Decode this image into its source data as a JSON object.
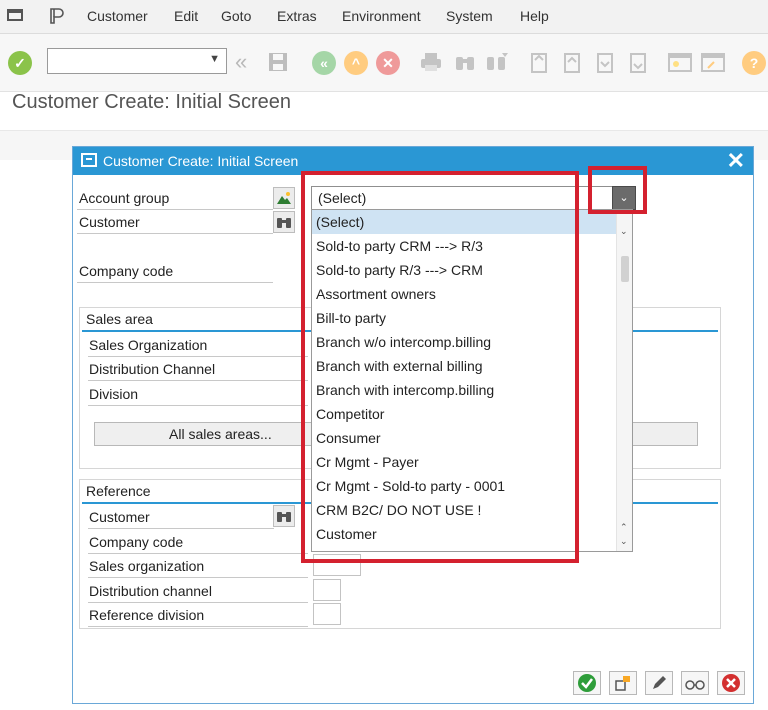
{
  "menu": {
    "items": [
      "Customer",
      "Edit",
      "Goto",
      "Extras",
      "Environment",
      "System",
      "Help"
    ]
  },
  "toolbar": {
    "command_field_value": "",
    "icons": [
      "enter-icon",
      "back-arrows-icon",
      "save-icon",
      "back-icon",
      "exit-icon",
      "cancel-icon",
      "print-icon",
      "find-icon",
      "find-next-icon",
      "first-page-icon",
      "previous-page-icon",
      "next-page-icon",
      "last-page-icon",
      "new-session-icon",
      "shortcut-icon",
      "help-icon"
    ]
  },
  "page": {
    "title": "Customer Create: Initial Screen"
  },
  "dialog": {
    "title": "Customer Create: Initial Screen",
    "account_group_label": "Account group",
    "customer_label": "Customer",
    "company_code_label": "Company code",
    "sales_area": {
      "title": "Sales area",
      "fields": [
        "Sales Organization",
        "Distribution Channel",
        "Division"
      ],
      "all_sales_areas_button": "All sales areas..."
    },
    "reference": {
      "title": "Reference",
      "fields": [
        "Customer",
        "Company code",
        "Sales organization",
        "Distribution channel",
        "Reference division"
      ]
    },
    "footer_buttons": [
      "continue-icon",
      "create-with-data-icon",
      "edit-icon",
      "glasses-icon",
      "cancel-icon"
    ]
  },
  "dropdown": {
    "selected_value": "(Select)",
    "options": [
      "(Select)",
      "Sold-to party CRM ---> R/3",
      "Sold-to party R/3 ---> CRM",
      "Assortment owners",
      "Bill-to party",
      "Branch w/o intercomp.billing",
      "Branch with external billing",
      "Branch with intercomp.billing",
      "Competitor",
      "Consumer",
      "Cr Mgmt - Payer",
      "Cr Mgmt - Sold-to party - 0001",
      "CRM B2C/ DO NOT USE !",
      "Customer"
    ]
  },
  "colors": {
    "dialog_header": "#2a97d4",
    "highlight_frame": "#d4212f",
    "selected_row": "#cfe3f3"
  }
}
